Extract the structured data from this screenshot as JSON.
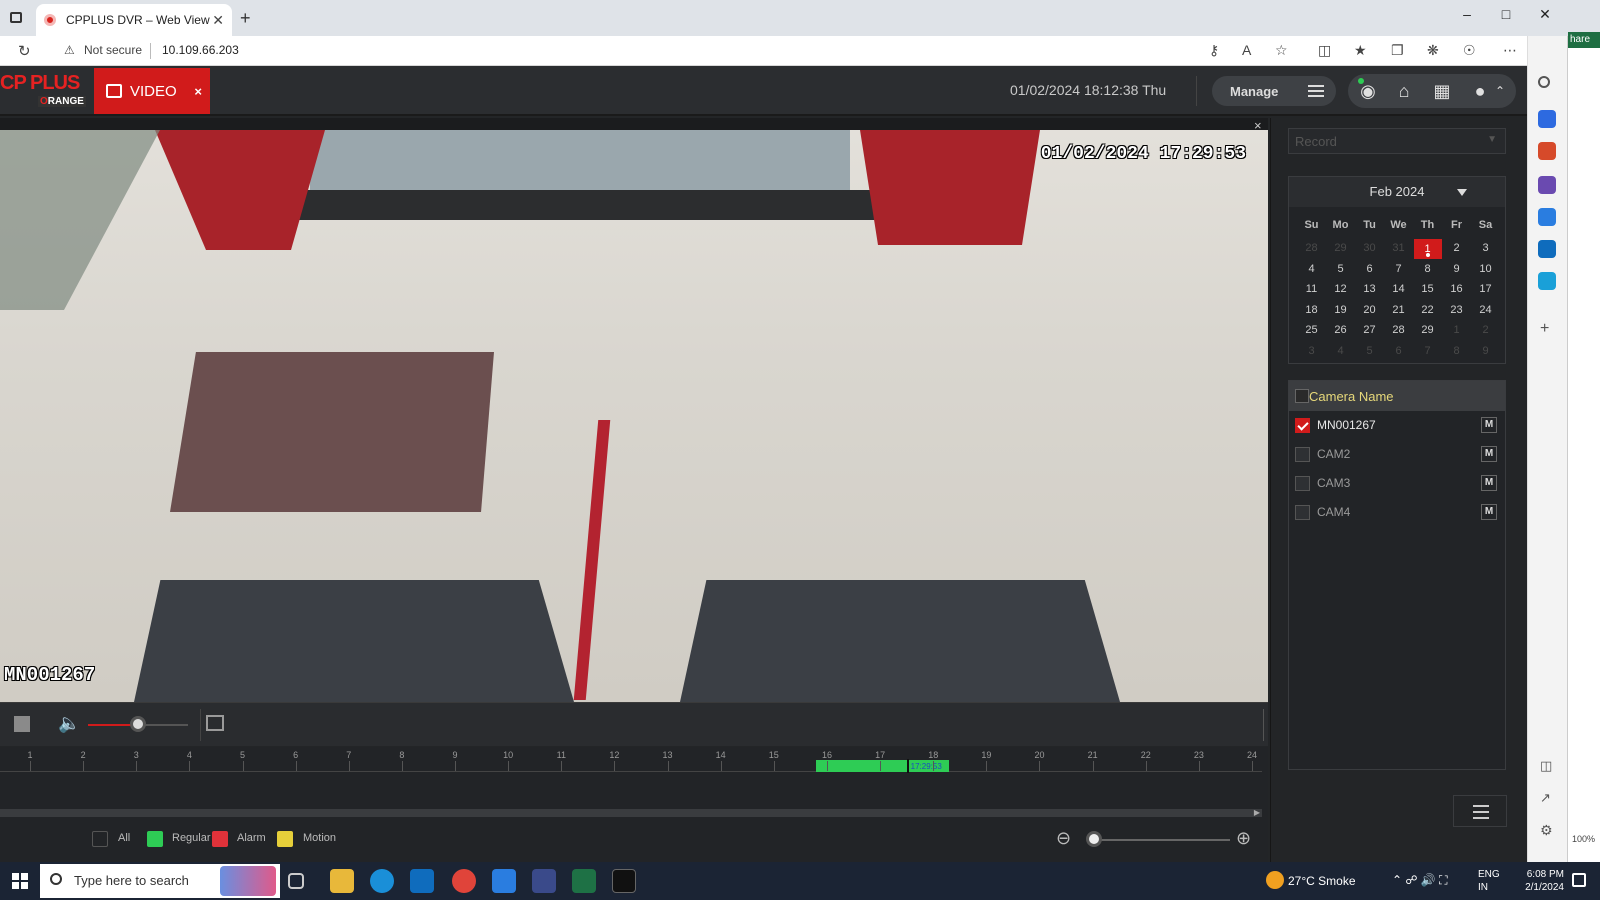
{
  "browser": {
    "tab_title": "CPPLUS DVR – Web View",
    "tab_close": "✕",
    "new_tab": "+",
    "security_label": "Not secure",
    "url": "10.109.66.203"
  },
  "app": {
    "logo_text": "CP PLUS",
    "logo_sub": "RANGE",
    "logo_sub_prefix": "O",
    "video_tab_label": "VIDEO",
    "video_tab_close": "×",
    "datetime": "01/02/2024 18:12:38 Thu",
    "manage_label": "Manage"
  },
  "video": {
    "osd_time": "01/02/2024 17:29:53",
    "osd_camera": "MN001267",
    "close_label": "×"
  },
  "player": {
    "volume_percent": 50
  },
  "timeline": {
    "hours": [
      "1",
      "2",
      "3",
      "4",
      "5",
      "6",
      "7",
      "8",
      "9",
      "10",
      "11",
      "12",
      "13",
      "14",
      "15",
      "16",
      "17",
      "18",
      "19",
      "20",
      "21",
      "22",
      "23",
      "24"
    ],
    "record_start_hour": 15.8,
    "record_end_hour": 18.3,
    "cursor_hour": 17.5,
    "cursor_label": "17:29:53",
    "record_color": "#2ecc55"
  },
  "legend": {
    "all_label": "All",
    "regular_label": "Regular",
    "alarm_label": "Alarm",
    "motion_label": "Motion",
    "regular_color": "#2ecc55",
    "alarm_color": "#e0323a",
    "motion_color": "#e6cf3a",
    "zoom_level_percent": 0
  },
  "panel": {
    "record_placeholder": "Record",
    "calendar_month": "Feb 2024",
    "dow": [
      "Su",
      "Mo",
      "Tu",
      "We",
      "Th",
      "Fr",
      "Sa"
    ],
    "weeks": [
      [
        {
          "d": "28",
          "dim": true
        },
        {
          "d": "29",
          "dim": true
        },
        {
          "d": "30",
          "dim": true
        },
        {
          "d": "31",
          "dim": true
        },
        {
          "d": "1",
          "sel": true
        },
        {
          "d": "2"
        },
        {
          "d": "3"
        }
      ],
      [
        {
          "d": "4"
        },
        {
          "d": "5"
        },
        {
          "d": "6"
        },
        {
          "d": "7"
        },
        {
          "d": "8"
        },
        {
          "d": "9"
        },
        {
          "d": "10"
        }
      ],
      [
        {
          "d": "11"
        },
        {
          "d": "12"
        },
        {
          "d": "13"
        },
        {
          "d": "14"
        },
        {
          "d": "15"
        },
        {
          "d": "16"
        },
        {
          "d": "17"
        }
      ],
      [
        {
          "d": "18"
        },
        {
          "d": "19"
        },
        {
          "d": "20"
        },
        {
          "d": "21"
        },
        {
          "d": "22"
        },
        {
          "d": "23"
        },
        {
          "d": "24"
        }
      ],
      [
        {
          "d": "25"
        },
        {
          "d": "26"
        },
        {
          "d": "27"
        },
        {
          "d": "28"
        },
        {
          "d": "29"
        },
        {
          "d": "1",
          "dim": true
        },
        {
          "d": "2",
          "dim": true
        }
      ],
      [
        {
          "d": "3",
          "dim": true
        },
        {
          "d": "4",
          "dim": true
        },
        {
          "d": "5",
          "dim": true
        },
        {
          "d": "6",
          "dim": true
        },
        {
          "d": "7",
          "dim": true
        },
        {
          "d": "8",
          "dim": true
        },
        {
          "d": "9",
          "dim": true
        }
      ]
    ],
    "camera_header": "Camera Name",
    "cameras": [
      {
        "name": "MN001267",
        "checked": true,
        "m": "M"
      },
      {
        "name": "CAM2",
        "checked": false,
        "m": "M"
      },
      {
        "name": "CAM3",
        "checked": false,
        "m": "M"
      },
      {
        "name": "CAM4",
        "checked": false,
        "m": "M"
      }
    ]
  },
  "taskbar": {
    "search_placeholder": "Type here to search",
    "weather": "27°C  Smoke",
    "lang_line1": "ENG",
    "lang_line2": "IN",
    "time": "6:08 PM",
    "date": "2/1/2024"
  },
  "edge": {
    "share_label": "hare",
    "zoom_label": "100%"
  }
}
